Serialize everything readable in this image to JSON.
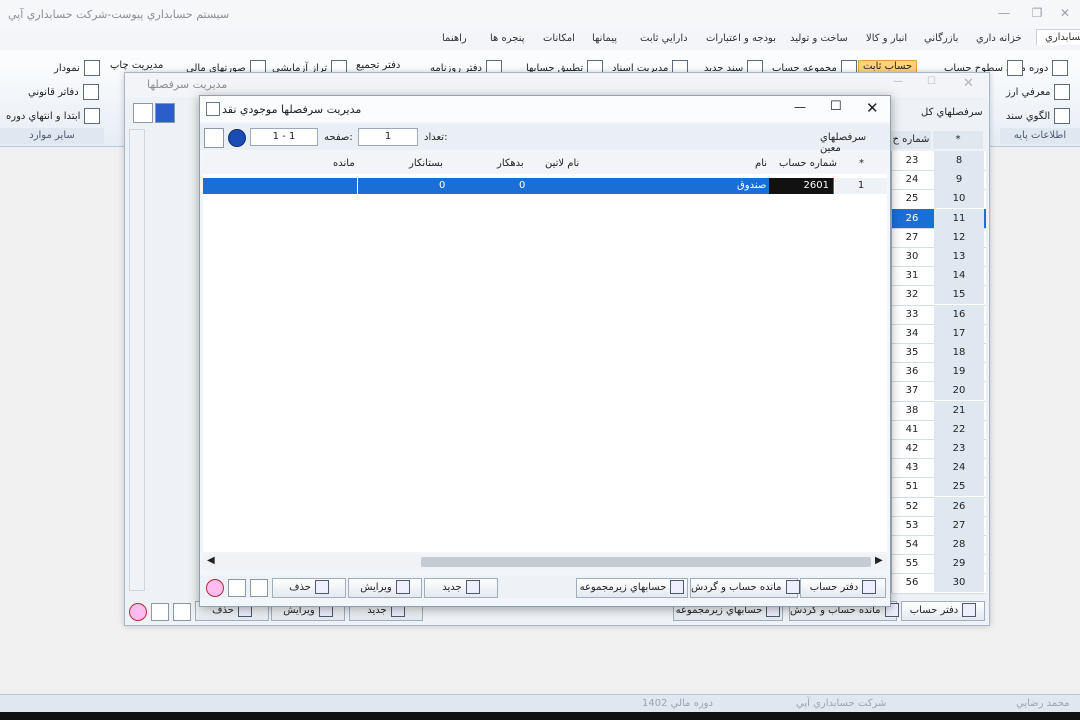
{
  "app": {
    "title": "سیستم حسابداري پیوست-شرکت حسابداري آپي"
  },
  "tabs": [
    "حسابداري",
    "خزانه داري",
    "بازرگاني",
    "انبار و کالا",
    "ساخت و تولید",
    "بودجه و اعتبارات",
    "دارايي ثابت",
    "پیمانها",
    "امکانات",
    "پنجره ها",
    "راهنما"
  ],
  "ribbon": {
    "right_items": [
      "دوره مالي",
      "معرفي ارز",
      "الگوي سند"
    ],
    "right_label": "سطوح حساب",
    "left_items": [
      "نمودار",
      "دفاتر قانوني",
      "ابتدا و انتهاي دوره"
    ],
    "mid_items": [
      "مجموعه حساب",
      "سند جديد",
      "مديريت اسناد",
      "تطبيق حسابها",
      "دفتر روزنامه",
      "دفتر تجميع",
      "تراز آزمايشي",
      "صورتهاي مالي",
      "مديريت چاپ"
    ],
    "highlighted": "حساب ثابت",
    "group_info": "اطلاعات پايه",
    "group_other": "ساير موارد"
  },
  "back_window": {
    "title": "مديريت سرفصلها",
    "panel_label": "سرفصلهاي كل",
    "col_number": "شماره ح",
    "rows": [
      {
        "a": "23",
        "b": "8"
      },
      {
        "a": "24",
        "b": "9"
      },
      {
        "a": "25",
        "b": "10"
      },
      {
        "a": "26",
        "b": "11"
      },
      {
        "a": "27",
        "b": "12"
      },
      {
        "a": "30",
        "b": "13"
      },
      {
        "a": "31",
        "b": "14"
      },
      {
        "a": "32",
        "b": "15"
      },
      {
        "a": "33",
        "b": "16"
      },
      {
        "a": "34",
        "b": "17"
      },
      {
        "a": "35",
        "b": "18"
      },
      {
        "a": "36",
        "b": "19"
      },
      {
        "a": "37",
        "b": "20"
      },
      {
        "a": "38",
        "b": "21"
      },
      {
        "a": "41",
        "b": "22"
      },
      {
        "a": "42",
        "b": "23"
      },
      {
        "a": "43",
        "b": "24"
      },
      {
        "a": "51",
        "b": "25"
      },
      {
        "a": "52",
        "b": "26"
      },
      {
        "a": "53",
        "b": "27"
      },
      {
        "a": "54",
        "b": "28"
      },
      {
        "a": "55",
        "b": "29"
      },
      {
        "a": "56",
        "b": "30"
      }
    ],
    "bottom_buttons": {
      "ledger": "دفتر حساب",
      "balance": "مانده حساب و گردش",
      "sub_accounts": "حسابهاي زيرمجموعه",
      "new": "جديد",
      "edit": "ويرايش",
      "delete": "حذف"
    }
  },
  "dialog": {
    "title": "مديريت سرفصلها موجودي نقد",
    "subtitle": "سرفصلهاي معين",
    "count_label": "تعداد:",
    "count_value": "1",
    "page_label": "صفحه:",
    "page_value": "1 - 1",
    "columns": {
      "star": "*",
      "account_number": "شماره حساب",
      "name": "نام",
      "latin_name": "نام لاتين",
      "debit": "بدهكار",
      "credit": "بستانكار",
      "balance": "مانده"
    },
    "rows": [
      {
        "index": "1",
        "account_number": "2601",
        "name": "صندوق",
        "latin_name": "",
        "debit": "0",
        "credit": "0",
        "balance": ""
      }
    ],
    "buttons": {
      "ledger": "دفتر حساب",
      "balance": "مانده حساب و گردش",
      "sub_accounts": "حسابهاي زيرمجموعه",
      "new": "جديد",
      "edit": "ويرايش",
      "delete": "حذف"
    }
  },
  "status": {
    "user": "محمد رضايي",
    "company": "شركت حسابداري آپي",
    "period": "دوره مالي 1402"
  }
}
